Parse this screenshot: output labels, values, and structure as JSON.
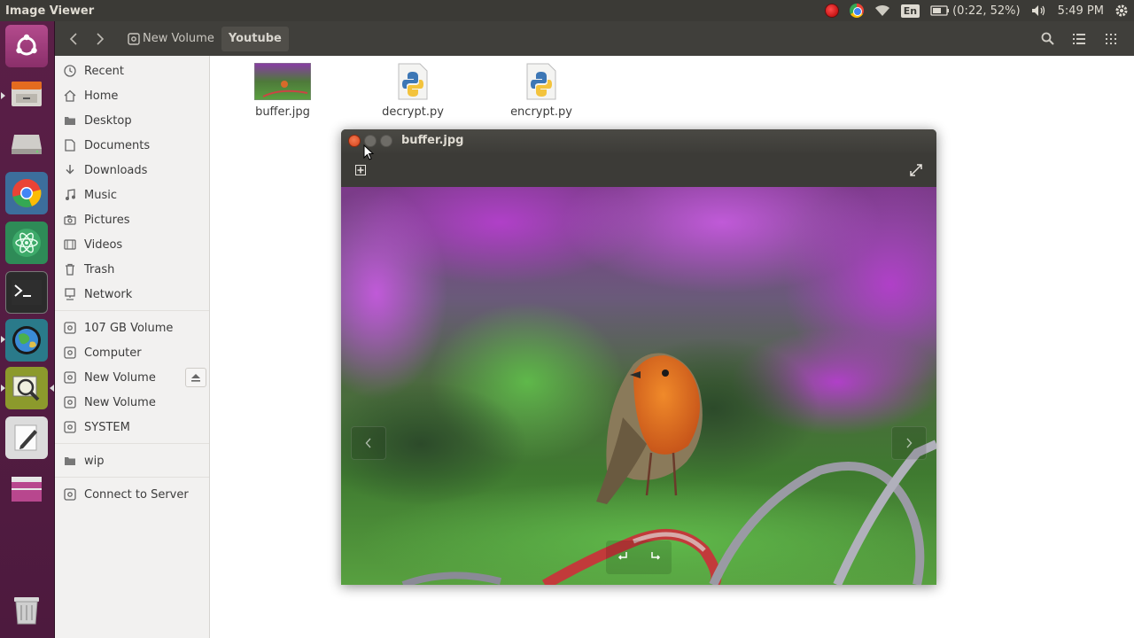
{
  "top_panel": {
    "app_title": "Image Viewer",
    "keyboard_layout": "En",
    "battery_text": "(0:22, 52%)",
    "clock": "5:49 PM"
  },
  "launcher": {
    "items": [
      "dash-home",
      "file-manager",
      "drive",
      "chrome",
      "atom",
      "terminal",
      "globe-app",
      "image-viewer",
      "text-editor",
      "workspace-switcher",
      "trash"
    ]
  },
  "nautilus": {
    "breadcrumbs": [
      "New Volume",
      "Youtube"
    ],
    "sidebar": {
      "places": [
        "Recent",
        "Home",
        "Desktop",
        "Documents",
        "Downloads",
        "Music",
        "Pictures",
        "Videos",
        "Trash",
        "Network"
      ],
      "devices": [
        "107 GB Volume",
        "Computer",
        "New Volume",
        "New Volume",
        "SYSTEM"
      ],
      "bookmarks": [
        "wip"
      ],
      "connect": "Connect to Server"
    },
    "files": [
      {
        "name": "buffer.jpg",
        "type": "image"
      },
      {
        "name": "decrypt.py",
        "type": "python"
      },
      {
        "name": "encrypt.py",
        "type": "python"
      }
    ]
  },
  "viewer": {
    "title": "buffer.jpg"
  },
  "colors": {
    "panel": "#3b3a36",
    "launcher": "#5a1f47",
    "header": "#403f3b",
    "sidebar": "#f2f1f0",
    "close_button": "#e9582d"
  }
}
